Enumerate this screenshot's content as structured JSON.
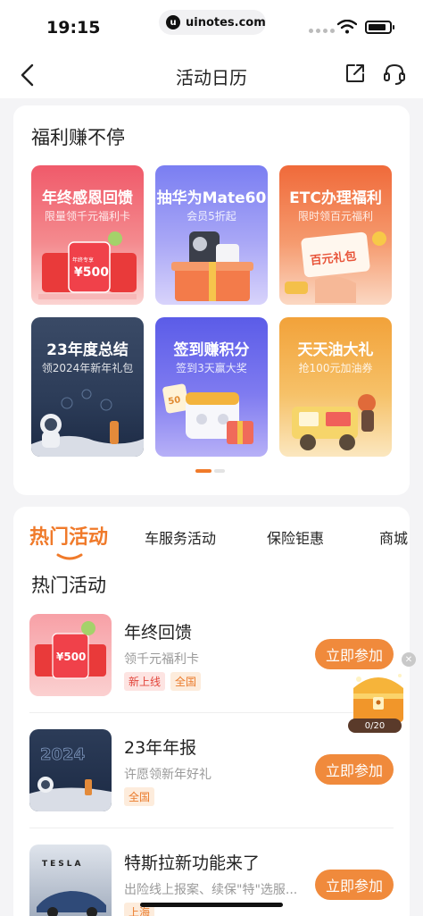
{
  "status_bar": {
    "time": "19:15",
    "url": "uinotes.com"
  },
  "nav": {
    "title": "活动日历"
  },
  "welfare": {
    "title": "福利赚不停",
    "tiles": [
      {
        "title": "年终感恩回馈",
        "subtitle": "限量领千元福利卡",
        "art_amount": "¥500"
      },
      {
        "title": "抽华为Mate60",
        "subtitle": "会员5折起"
      },
      {
        "title": "ETC办理福利",
        "subtitle": "限时领百元福利",
        "art_text": "百元礼包"
      },
      {
        "title": "23年度总结",
        "subtitle": "领2024年新年礼包"
      },
      {
        "title": "签到赚积分",
        "subtitle": "签到3天赢大奖",
        "art_points": "50"
      },
      {
        "title": "天天油大礼",
        "subtitle": "抢100元加油券"
      }
    ]
  },
  "activities": {
    "tabs": [
      "热门活动",
      "车服务活动",
      "保险钜惠",
      "商城"
    ],
    "list_title": "热门活动",
    "items": [
      {
        "title": "年终回馈",
        "desc": "领千元福利卡",
        "tags": [
          "新上线",
          "全国"
        ],
        "button": "立即参加",
        "thumb_text": "¥500"
      },
      {
        "title": "23年年报",
        "desc": "许愿领新年好礼",
        "tags": [
          "全国"
        ],
        "button": "立即参加",
        "thumb_text": "2024"
      },
      {
        "title": "特斯拉新功能来了",
        "desc": "出险线上报案、续保\"特\"选服...",
        "tags": [
          "上海"
        ],
        "button": "立即参加",
        "thumb_text": "TESLA"
      }
    ]
  },
  "floating_chest": {
    "progress": "0/20"
  },
  "colors": {
    "accent": "#f07a2a",
    "button": "#f08a3c"
  }
}
